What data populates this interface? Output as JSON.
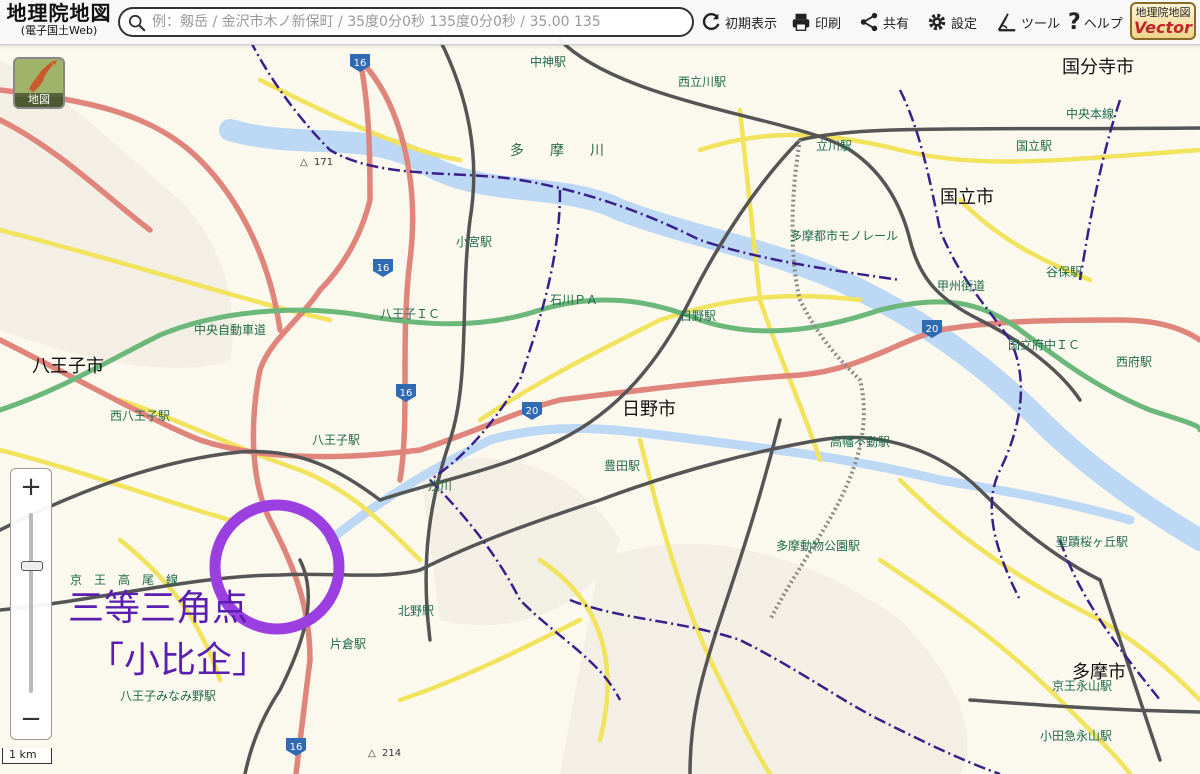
{
  "app": {
    "title": "地理院地図",
    "subtitle": "(電子国土Web)"
  },
  "search": {
    "placeholder": "例：剱岳 / 金沢市木ノ新保町 / 35度0分0秒 135度0分0秒 / 35.00 135"
  },
  "toolbar": {
    "reset_label": "初期表示",
    "print_label": "印刷",
    "share_label": "共有",
    "settings_label": "設定",
    "tools_label": "ツール",
    "help_label": "ヘルプ"
  },
  "badge": {
    "line1": "地理院地図",
    "line2": "Vector"
  },
  "layer_button": {
    "label": "地図"
  },
  "zoom": {
    "in_label": "+",
    "out_label": "−"
  },
  "scale": {
    "label": "1 km"
  },
  "annotation": {
    "line1": "三等三角点",
    "line2": "「小比企」"
  },
  "colors": {
    "national_road": "#e0857c",
    "expressway": "#6cb77a",
    "prefectural_road": "#f2e35c",
    "river": "#bcd8f5",
    "boundary": "#3a1f8a",
    "rail": "#555555",
    "highlight_circle": "#9b3fe0",
    "annotation_text": "#5a1fb0"
  },
  "labels": {
    "kokubunji": "国分寺市",
    "kunitachi": "国立市",
    "hachioji": "八王子市",
    "hino": "日野市",
    "tama": "多摩市",
    "nakagami": "中神駅",
    "nishitachikawa": "西立川駅",
    "chuohonsen": "中央本線",
    "kunitachi_st": "国立駅",
    "tamagawa": "多　摩　川",
    "tachikawa": "立川駅",
    "komiya": "小宮駅",
    "ishikawa_pa": "石川ＰＡ",
    "hachioji_ic": "八王子ＩＣ",
    "chuo_expwy": "中央自動車道",
    "hino_st": "日野駅",
    "koshu": "甲州街道",
    "yaho": "谷保駅",
    "kunitachifuchu_ic": "国立府中ＩＣ",
    "nishifu": "西府駅",
    "tama_monorail": "多摩都市モノレール",
    "nishihachioji": "西八王子駅",
    "hachioji_st": "八王子駅",
    "toyoda": "豊田駅",
    "asakawa": "浅川",
    "takahata": "高幡不動駅",
    "keio_takao": "京　王　高　尾　線",
    "tama_zoo": "多摩動物公園駅",
    "seiseki": "聖蹟桜ヶ丘駅",
    "kitano": "北野駅",
    "katakura": "片倉駅",
    "minamino": "八王子みなみ野駅",
    "keio_nagayama": "京王永山駅",
    "odakyu_nagayama": "小田急永山駅",
    "route16": "16",
    "route20": "20",
    "h171": "171",
    "h214": "214"
  }
}
